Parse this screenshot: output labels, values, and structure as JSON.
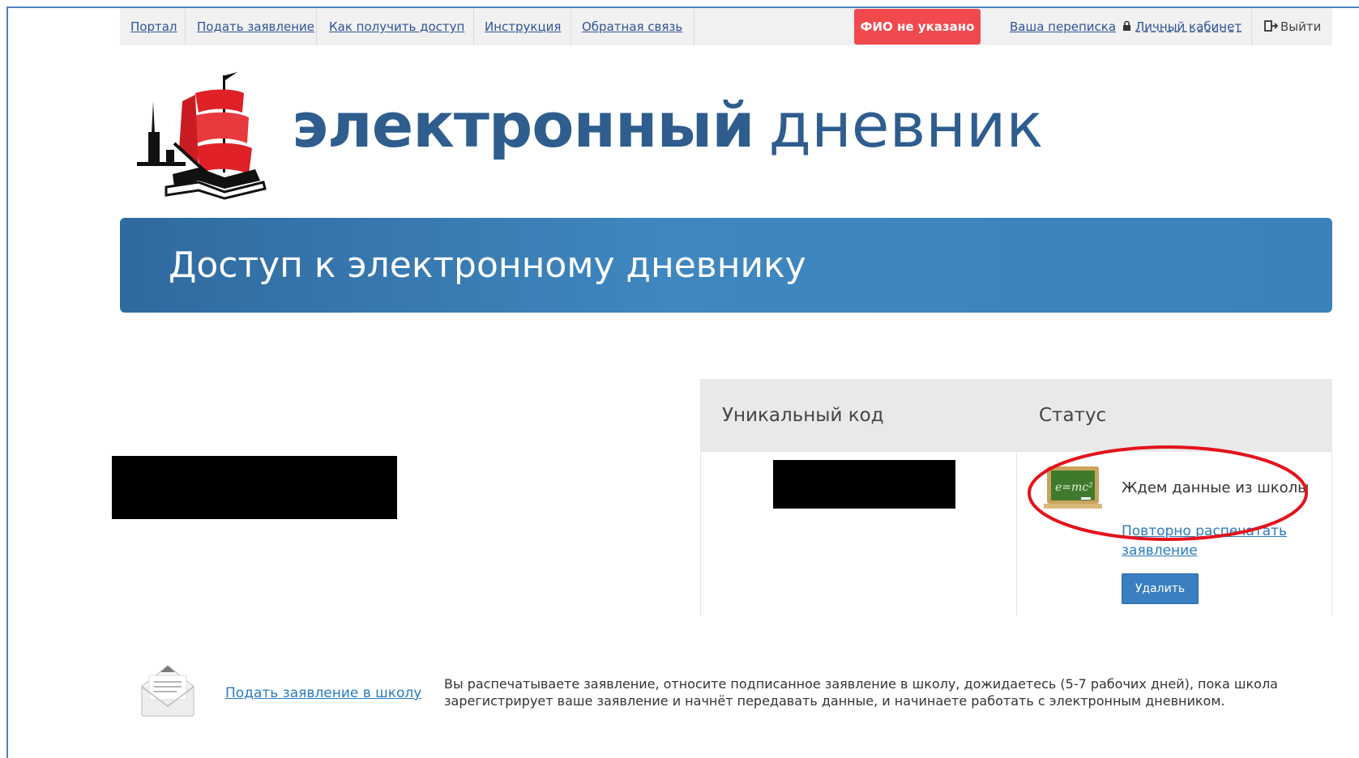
{
  "nav": {
    "portal": "Портал",
    "apply": "Подать заявление",
    "how_access": "Как получить доступ",
    "instructions": "Инструкция",
    "feedback": "Обратная связь",
    "fio_badge": "ФИО не указано",
    "correspondence": "Ваша переписка",
    "cabinet": "Личный кабинет",
    "logout": "Выйти"
  },
  "brand": {
    "bold": "электронный",
    "thin": "дневник"
  },
  "banner": {
    "title": "Доступ к электронному дневнику"
  },
  "table": {
    "col_code": "Уникальный код",
    "col_status": "Статус",
    "status_text": "Ждем данные из школы",
    "reprint_link": "Повторно распечатать заявление",
    "delete_button": "Удалить"
  },
  "footer": {
    "apply_link": "Подать заявление в школу",
    "description": "Вы распечатываете заявление, относите подписанное заявление в школу, дожидаетесь (5-7 рабочих дней), пока школа зарегистрирует ваше заявление и начнёт передавать данные, и начинаете работать с электронным дневником."
  },
  "icons": {
    "logo": "scarlet-sails-ship-logo",
    "lock": "lock-icon",
    "exit": "exit-icon",
    "status": "chalkboard-icon",
    "footer": "envelope-icon"
  },
  "colors": {
    "brand": "#2e5d8e",
    "banner": "#3f87bf",
    "badge": "#f04a4f",
    "link": "#2a7bbf",
    "button": "#3a7fc0",
    "annotation": "#e3131b"
  }
}
